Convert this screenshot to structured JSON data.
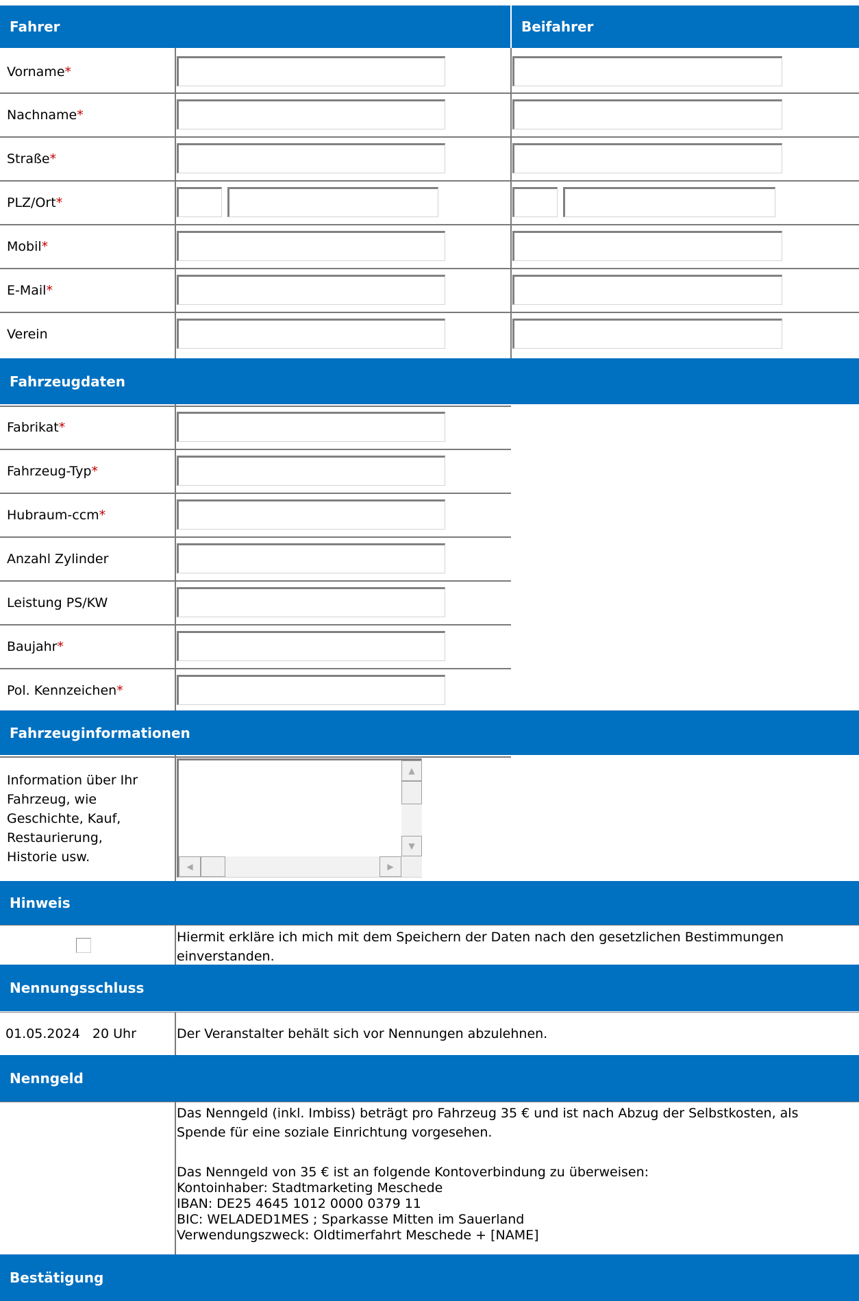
{
  "headers": {
    "fahrer": "Fahrer",
    "beifahrer": "Beifahrer",
    "fahrzeugdaten": "Fahrzeugdaten",
    "fahrzeuginformationen": "Fahrzeuginformationen",
    "hinweis": "Hinweis",
    "nennungsschluss": "Nennungsschluss",
    "nenngeld": "Nenngeld",
    "bestaetigung": "Bestätigung"
  },
  "required_mark": "*",
  "personal": {
    "vorname": "Vorname",
    "nachname": "Nachname",
    "strasse": "Straße",
    "plz_ort": "PLZ/Ort",
    "mobil": "Mobil",
    "email": "E-Mail",
    "verein": "Verein"
  },
  "vehicle": {
    "fabrikat": "Fabrikat",
    "typ": "Fahrzeug-Typ",
    "hubraum": "Hubraum-ccm",
    "zylinder": "Anzahl Zylinder",
    "leistung": "Leistung PS/KW",
    "baujahr": "Baujahr",
    "kennzeichen": "Pol. Kennzeichen"
  },
  "info": {
    "label_lines": [
      "Information über Ihr",
      "Fahrzeug, wie",
      "Geschichte, Kauf,",
      "Restaurierung,",
      "Historie usw."
    ],
    "textarea_value": ""
  },
  "hinweis": {
    "checked": false,
    "text_line1": "Hiermit erkläre ich mich mit dem Speichern der Daten nach den gesetzlichen Bestimmungen",
    "text_line2": "einverstanden."
  },
  "deadline": {
    "date": "01.05.2024   20 Uhr",
    "text": "Der Veranstalter behält sich vor Nennungen abzulehnen."
  },
  "fee": {
    "line1": "Das Nenngeld (inkl. Imbiss) beträgt pro Fahrzeug 35 € und ist nach Abzug der Selbstkosten, als",
    "line2": "Spende für eine soziale Einrichtung vorgesehen.",
    "line3": "Das Nenngeld von 35 € ist an folgende Kontoverbindung zu überweisen:",
    "line4": "Kontoinhaber: Stadtmarketing Meschede",
    "line5": "IBAN: DE25 4645 1012 0000 0379 11",
    "line6": "BIC: WELADED1MES ; Sparkasse Mitten im Sauerland",
    "line7": "Verwendungszweck: Oldtimerfahrt Meschede + [NAME]"
  },
  "colors": {
    "header_bg": "#0070c0",
    "required": "#c00000"
  }
}
